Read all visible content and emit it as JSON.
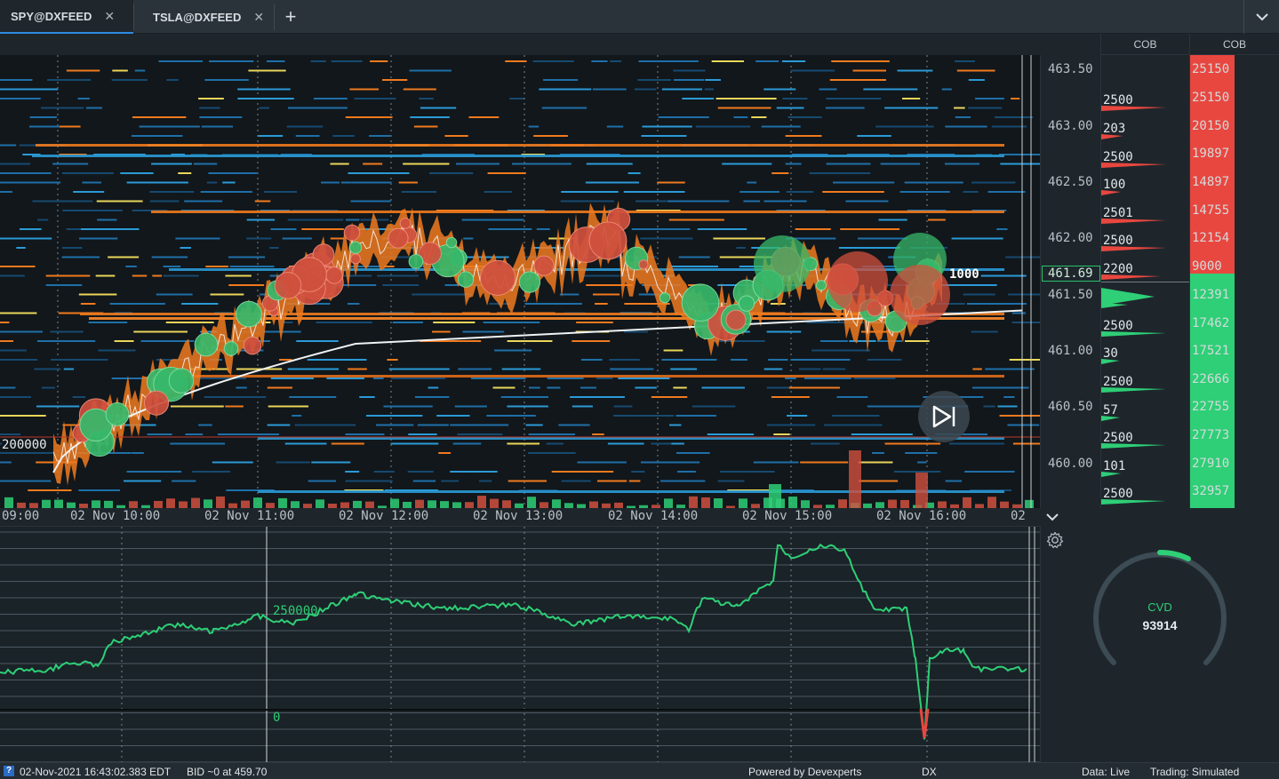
{
  "tabs": [
    {
      "label": "SPY@DXFEED",
      "active": true
    },
    {
      "label": "TSLA@DXFEED",
      "active": false
    }
  ],
  "tab_close_glyph": "✕",
  "add_tab_glyph": "+",
  "price_axis": {
    "labels": [
      "463.50",
      "463.00",
      "462.50",
      "462.00",
      "461.50",
      "461.00",
      "460.50",
      "460.00"
    ],
    "current_price": "461.69"
  },
  "chart": {
    "left_level_label": "200000",
    "last_trade_label": "1000",
    "time_labels": [
      "09:00",
      "02 Nov 10:00",
      "02 Nov 11:00",
      "02 Nov 12:00",
      "02 Nov 13:00",
      "02 Nov 14:00",
      "02 Nov 15:00",
      "02 Nov 16:00",
      "02"
    ]
  },
  "cob": {
    "col1_title": "COB",
    "col2_title": "COB",
    "col1_values": [
      "2500",
      "203",
      "2500",
      "100",
      "2501",
      "2500",
      "2200",
      "",
      "2500",
      "30",
      "2500",
      "57",
      "2500",
      "101",
      "2500"
    ],
    "col2_values": [
      "25150",
      "25150",
      "20150",
      "19897",
      "14897",
      "14755",
      "12154",
      "9000",
      "12391",
      "17462",
      "17521",
      "22666",
      "22755",
      "27773",
      "27910",
      "32957"
    ]
  },
  "cvd": {
    "levels": [
      "250000",
      "0"
    ],
    "gauge_title": "CVD",
    "gauge_value": "93914"
  },
  "status": {
    "datetime": "02-Nov-2021 16:43:02.383 EDT",
    "bid": "BID ~0 at 459.70",
    "powered": "Powered by Devexperts",
    "dx": "DX",
    "data": "Data: Live",
    "trading": "Trading: Simulated"
  },
  "colors": {
    "ask": "#e8473f",
    "bid": "#2ecf76",
    "accent": "#2f8ae0"
  },
  "icons": [
    "close-icon",
    "plus-icon",
    "chevron-down-icon",
    "gear-icon",
    "play-next-icon",
    "info-icon"
  ]
}
